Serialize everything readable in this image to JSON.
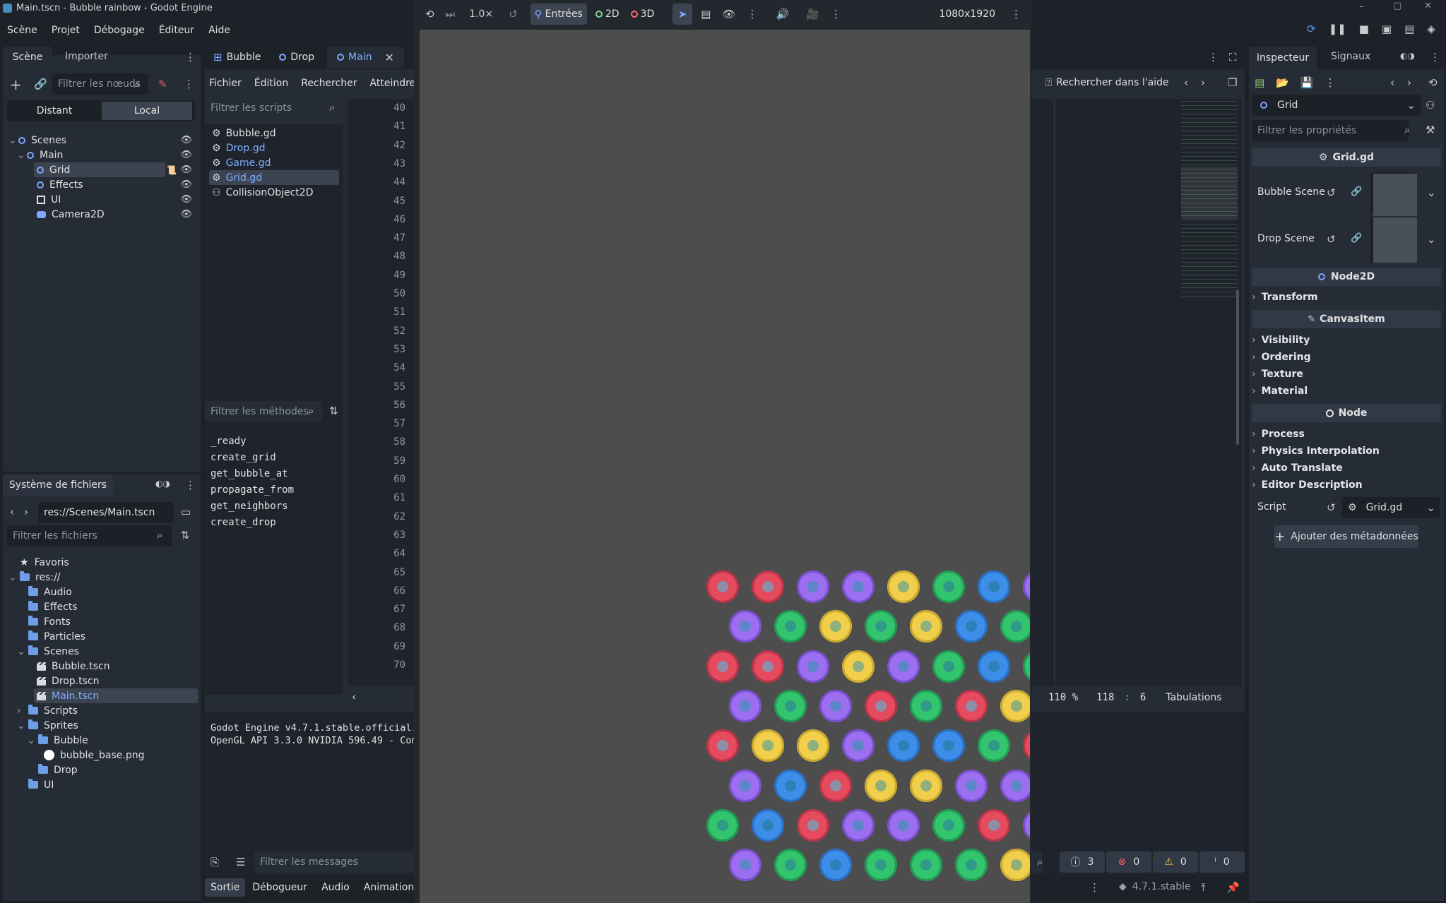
{
  "window": {
    "title": "Main.tscn - Bubble rainbow - Godot Engine",
    "minimize": "–",
    "maximize": "▢",
    "close": "✕"
  },
  "menubar": [
    "Scène",
    "Projet",
    "Débogage",
    "Éditeur",
    "Aide"
  ],
  "game_toolbar": {
    "speed": "1.0×",
    "input_label": "Entrées",
    "mode_2d": "2D",
    "mode_3d": "3D",
    "resolution": "1080x1920"
  },
  "scene_dock": {
    "tabs": [
      "Scène",
      "Importer"
    ],
    "filter_placeholder": "Filtrer les nœuds",
    "remote_label": "Distant",
    "local_label": "Local",
    "tree": [
      {
        "label": "Scenes",
        "depth": 0
      },
      {
        "label": "Main",
        "depth": 1
      },
      {
        "label": "Grid",
        "depth": 2,
        "selected": true
      },
      {
        "label": "Effects",
        "depth": 2
      },
      {
        "label": "UI",
        "depth": 2
      },
      {
        "label": "Camera2D",
        "depth": 2
      }
    ]
  },
  "filesystem": {
    "title": "Système de fichiers",
    "path": "res://Scenes/Main.tscn",
    "filter_placeholder": "Filtrer les fichiers",
    "favorites": "Favoris",
    "root": "res://",
    "items": [
      {
        "label": "Audio"
      },
      {
        "label": "Effects"
      },
      {
        "label": "Fonts"
      },
      {
        "label": "Particles"
      },
      {
        "label": "Scenes"
      },
      {
        "label": "Bubble.tscn"
      },
      {
        "label": "Drop.tscn"
      },
      {
        "label": "Main.tscn"
      },
      {
        "label": "Scripts"
      },
      {
        "label": "Sprites"
      },
      {
        "label": "Bubble"
      },
      {
        "label": "bubble_base.png"
      },
      {
        "label": "Drop"
      },
      {
        "label": "UI"
      }
    ]
  },
  "editor_tabs": [
    "Bubble",
    "Drop",
    "Main"
  ],
  "script_menu": [
    "Fichier",
    "Édition",
    "Rechercher",
    "Atteindre"
  ],
  "search_help": "Rechercher dans l'aide",
  "scripts": {
    "filter_placeholder": "Filtrer les scripts",
    "items": [
      "Bubble.gd",
      "Drop.gd",
      "Game.gd",
      "Grid.gd",
      "CollisionObject2D"
    ]
  },
  "methods": {
    "filter_placeholder": "Filtrer les méthodes",
    "items": [
      "_ready",
      "create_grid",
      "get_bubble_at",
      "propagate_from",
      "get_neighbors",
      "create_drop"
    ]
  },
  "line_numbers": [
    "40",
    "41",
    "42",
    "43",
    "44",
    "45",
    "46",
    "47",
    "48",
    "49",
    "50",
    "51",
    "52",
    "53",
    "54",
    "55",
    "56",
    "57",
    "58",
    "59",
    "60",
    "61",
    "62",
    "63",
    "64",
    "65",
    "66",
    "67",
    "68",
    "69",
    "70"
  ],
  "statusbar": {
    "zoom": "110 %",
    "line": "118",
    "col": "6",
    "indent": "Tabulations"
  },
  "output": {
    "line1": "Godot Engine v4.7.1.stable.official.",
    "line2": "OpenGL API 3.3.0 NVIDIA 596.49 - Com",
    "filter_placeholder": "Filtrer les messages",
    "count_info": "3",
    "count_err": "0",
    "count_warn": "0",
    "count_msg": "0"
  },
  "bottom_tabs": [
    "Sortie",
    "Débogueur",
    "Audio",
    "Animation"
  ],
  "version": "4.7.1.stable",
  "inspector": {
    "tabs": [
      "Inspecteur",
      "Signaux"
    ],
    "node_name": "Grid",
    "filter_placeholder": "Filtrer les propriétés",
    "script_header": "Grid.gd",
    "props": {
      "bubble_scene": "Bubble Scene",
      "drop_scene": "Drop Scene"
    },
    "cat_node2d": "Node2D",
    "cat_canvas": "CanvasItem",
    "cat_node": "Node",
    "sections": {
      "transform": "Transform",
      "visibility": "Visibility",
      "ordering": "Ordering",
      "texture": "Texture",
      "material": "Material",
      "process": "Process",
      "physics": "Physics Interpolation",
      "auto_translate": "Auto Translate",
      "editor_desc": "Editor Description"
    },
    "script_label": "Script",
    "script_value": "Grid.gd",
    "add_meta": "Ajouter des métadonnées"
  },
  "bubbles": {
    "rows": [
      [
        "r",
        "r",
        "p",
        "p",
        "y",
        "g",
        "b",
        "p"
      ],
      [
        "p",
        "g",
        "y",
        "g",
        "y",
        "b",
        "g"
      ],
      [
        "r",
        "r",
        "p",
        "y",
        "p",
        "g",
        "b",
        "g"
      ],
      [
        "p",
        "g",
        "p",
        "r",
        "g",
        "r",
        "y"
      ],
      [
        "r",
        "y",
        "y",
        "p",
        "b",
        "b",
        "g",
        "r"
      ],
      [
        "p",
        "b",
        "r",
        "y",
        "y",
        "p",
        "p"
      ],
      [
        "g",
        "b",
        "r",
        "p",
        "p",
        "g",
        "r",
        "p"
      ],
      [
        "p",
        "g",
        "b",
        "g",
        "g",
        "g",
        "y"
      ]
    ]
  }
}
